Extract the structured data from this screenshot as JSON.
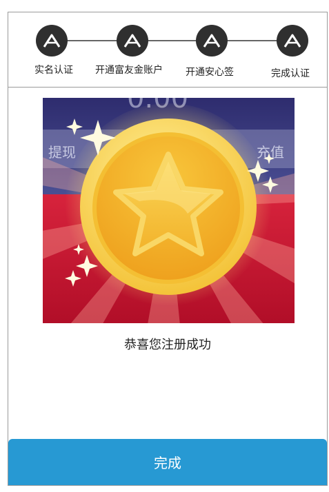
{
  "steps": [
    {
      "label": "实名认证",
      "icon": "logo-a-icon"
    },
    {
      "label": "开通富友金账户",
      "icon": "logo-a-icon"
    },
    {
      "label": "开通安心签",
      "icon": "logo-a-icon"
    },
    {
      "label": "完成认证",
      "icon": "logo-a-icon"
    }
  ],
  "illustration": {
    "background_text_left": "提现",
    "background_text_right": "充值",
    "background_text_top": "0.00",
    "colors": {
      "top_band": "#3a3f85",
      "bottom_band": "#c3142f",
      "coin_outer": "#f8cf3a",
      "coin_inner": "#f3b52a",
      "star": "#f7c437"
    }
  },
  "success_message": "恭喜您注册成功",
  "done_button_label": "完成",
  "colors": {
    "accent": "#2799d3",
    "step_circle": "#2f2f2f"
  }
}
